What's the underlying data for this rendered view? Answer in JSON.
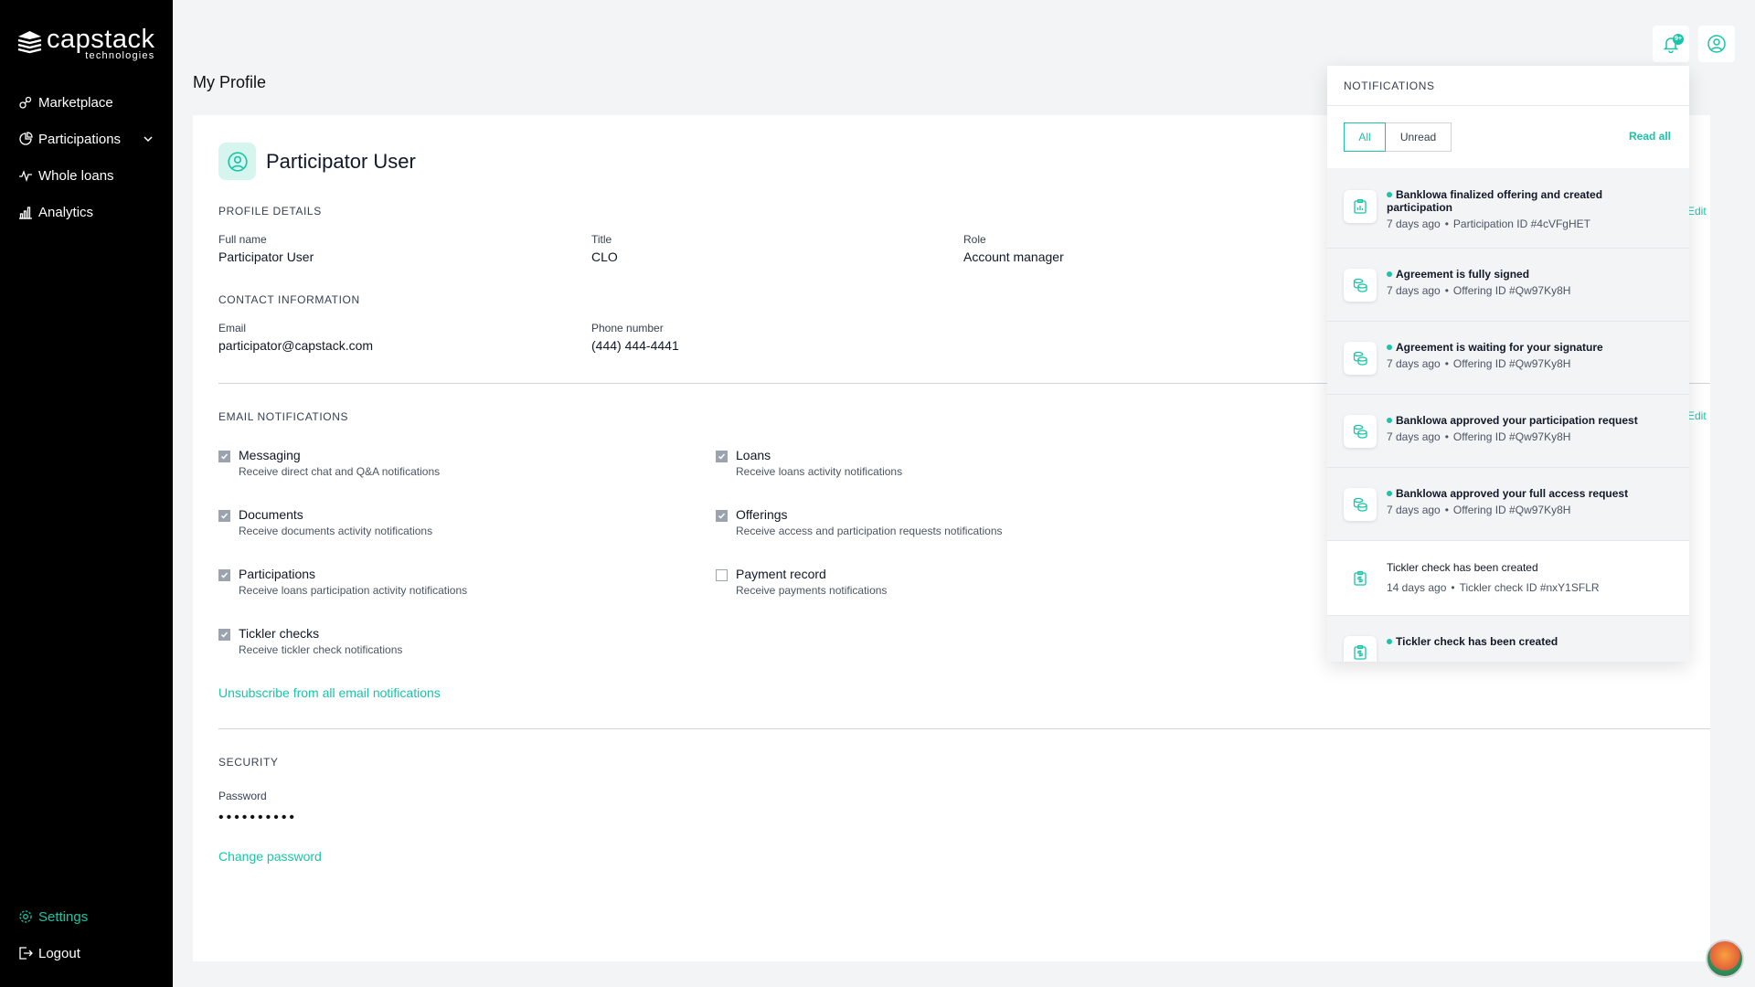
{
  "brand": {
    "name": "capstack",
    "sub": "technologies"
  },
  "sidebar": {
    "items": [
      {
        "label": "Marketplace",
        "icon": "marketplace-icon"
      },
      {
        "label": "Participations",
        "icon": "pie-chart-icon"
      },
      {
        "label": "Whole loans",
        "icon": "activity-icon"
      },
      {
        "label": "Analytics",
        "icon": "bar-chart-icon"
      }
    ],
    "bottom": [
      {
        "label": "Settings",
        "icon": "gear-icon",
        "active": true
      },
      {
        "label": "Logout",
        "icon": "logout-icon"
      }
    ]
  },
  "header": {
    "title": "My Profile",
    "bell_badge": "9+"
  },
  "profile": {
    "name": "Participator User",
    "details_label": "PROFILE DETAILS",
    "full_name_label": "Full name",
    "full_name": "Participator User",
    "title_label": "Title",
    "title": "CLO",
    "role_label": "Role",
    "role": "Account manager",
    "edit_label": "Edit",
    "contact_label": "CONTACT INFORMATION",
    "email_label": "Email",
    "email": "participator@capstack.com",
    "phone_label": "Phone number",
    "phone": "(444) 444-4441"
  },
  "email_notifications": {
    "label": "EMAIL NOTIFICATIONS",
    "edit_label": "Edit",
    "items": [
      {
        "title": "Messaging",
        "desc": "Receive direct chat and Q&A notifications",
        "checked": true
      },
      {
        "title": "Loans",
        "desc": "Receive loans activity notifications",
        "checked": true
      },
      {
        "title": "Documents",
        "desc": "Receive documents activity notifications",
        "checked": true
      },
      {
        "title": "Offerings",
        "desc": "Receive access and participation requests notifications",
        "checked": true
      },
      {
        "title": "Participations",
        "desc": "Receive loans participation activity notifications",
        "checked": true
      },
      {
        "title": "Payment record",
        "desc": "Receive payments notifications",
        "checked": false
      },
      {
        "title": "Tickler checks",
        "desc": "Receive tickler check notifications",
        "checked": true
      }
    ],
    "unsubscribe": "Unsubscribe from all email notifications"
  },
  "security": {
    "label": "SECURITY",
    "password_label": "Password",
    "password_value": "••••••••••",
    "change": "Change password"
  },
  "notifications": {
    "title": "NOTIFICATIONS",
    "tab_all": "All",
    "tab_unread": "Unread",
    "read_all": "Read all",
    "items": [
      {
        "title": "Banklowa finalized offering and created participation",
        "time": "7 days ago",
        "ref": "Participation ID #4cVFgHET",
        "unread": true,
        "icon": "clipboard-chart-icon"
      },
      {
        "title": "Agreement is fully signed",
        "time": "7 days ago",
        "ref": "Offering ID #Qw97Ky8H",
        "unread": true,
        "icon": "coins-icon"
      },
      {
        "title": "Agreement is waiting for your signature",
        "time": "7 days ago",
        "ref": "Offering ID #Qw97Ky8H",
        "unread": true,
        "icon": "coins-icon"
      },
      {
        "title": "Banklowa approved your participation request",
        "time": "7 days ago",
        "ref": "Offering ID #Qw97Ky8H",
        "unread": true,
        "icon": "coins-icon"
      },
      {
        "title": "Banklowa approved your full access request",
        "time": "7 days ago",
        "ref": "Offering ID #Qw97Ky8H",
        "unread": true,
        "icon": "coins-icon"
      },
      {
        "title": "Tickler check has been created",
        "time": "14 days ago",
        "ref": "Tickler check ID #nxY1SFLR",
        "unread": false,
        "icon": "clipboard-dollar-icon"
      },
      {
        "title": "Tickler check has been created",
        "time": "",
        "ref": "",
        "unread": true,
        "icon": "clipboard-dollar-icon"
      }
    ]
  },
  "colors": {
    "accent": "#19c4a8",
    "sidebar": "#000000",
    "background": "#f3f4f6"
  }
}
